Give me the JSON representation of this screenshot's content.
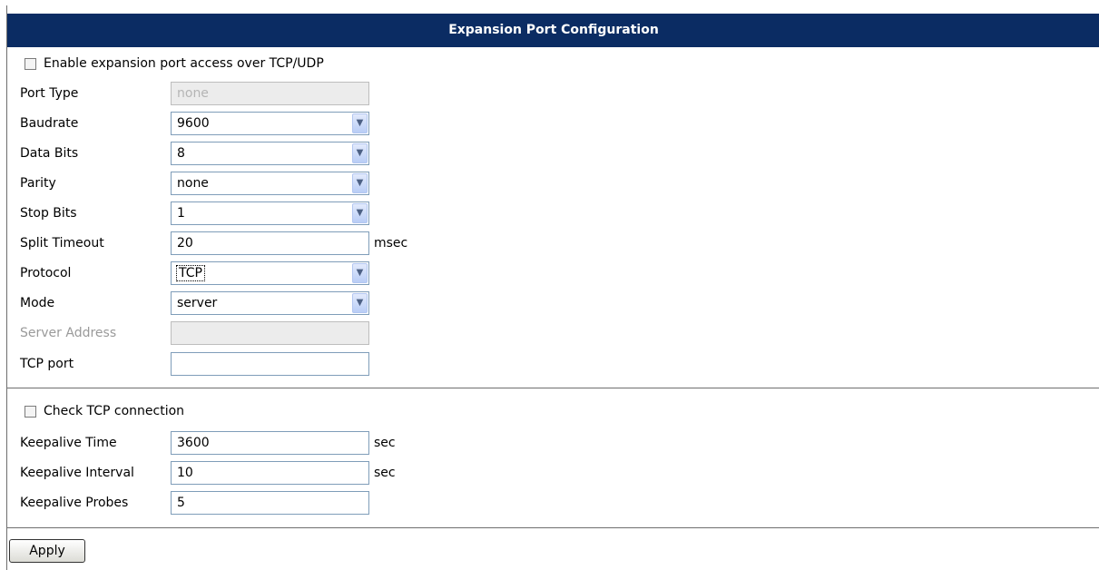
{
  "title": "Expansion Port Configuration",
  "enable_checkbox_label": "Enable expansion port access over TCP/UDP",
  "fields": {
    "port_type": {
      "label": "Port Type",
      "value": "none"
    },
    "baudrate": {
      "label": "Baudrate",
      "value": "9600"
    },
    "data_bits": {
      "label": "Data Bits",
      "value": "8"
    },
    "parity": {
      "label": "Parity",
      "value": "none"
    },
    "stop_bits": {
      "label": "Stop Bits",
      "value": "1"
    },
    "split_timeout": {
      "label": "Split Timeout",
      "value": "20",
      "unit": "msec"
    },
    "protocol": {
      "label": "Protocol",
      "value": "TCP"
    },
    "mode": {
      "label": "Mode",
      "value": "server"
    },
    "server_address": {
      "label": "Server Address",
      "value": ""
    },
    "tcp_port": {
      "label": "TCP port",
      "value": ""
    }
  },
  "check_tcp_label": "Check TCP connection",
  "keepalive": {
    "time": {
      "label": "Keepalive Time",
      "value": "3600",
      "unit": "sec"
    },
    "interval": {
      "label": "Keepalive Interval",
      "value": "10",
      "unit": "sec"
    },
    "probes": {
      "label": "Keepalive Probes",
      "value": "5"
    }
  },
  "apply_label": "Apply",
  "icons": {
    "dropdown": "chevron-down-icon",
    "checkbox": "checkbox-unchecked-icon"
  },
  "colors": {
    "title_bar": "#0b2c63",
    "title_text": "#ffffff",
    "field_border": "#7f9db9",
    "disabled_text": "#9a9a9a"
  }
}
